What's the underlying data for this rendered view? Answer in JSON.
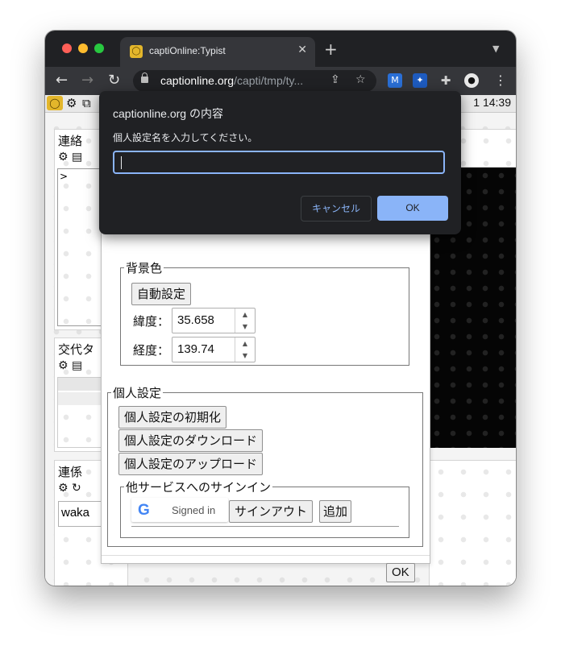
{
  "browser": {
    "tab_title": "captiOnline:Typist",
    "tab_close": "✕",
    "new_tab": "+",
    "url_host": "captionline.org",
    "url_path": "/capti/tmp/ty..."
  },
  "appbar": {
    "clock_count": "1",
    "clock_time": "14:39"
  },
  "left_panels": {
    "contact": {
      "title": "連絡",
      "prompt": ">"
    },
    "shift": {
      "title": "交代タ"
    },
    "relation": {
      "title": "連係",
      "input_value": "waka"
    }
  },
  "settings": {
    "background": {
      "legend": "背景色",
      "auto_button": "自動設定",
      "lat_label": "緯度：",
      "lat_value": "35.658",
      "lon_label": "経度：",
      "lon_value": "139.74"
    },
    "personal": {
      "legend": "個人設定",
      "init_button": "個人設定の初期化",
      "download_button": "個人設定のダウンロード",
      "upload_button": "個人設定のアップロード",
      "signin": {
        "legend": "他サービスへのサインイン",
        "google_logo": "G",
        "google_status": "Signed in",
        "signout_button": "サインアウト",
        "add_button": "追加"
      }
    },
    "ok_button": "OK"
  },
  "dialog": {
    "title": "captionline.org の内容",
    "message": "個人設定名を入力してください。",
    "input_value": "",
    "cancel_label": "キャンセル",
    "ok_label": "OK"
  }
}
